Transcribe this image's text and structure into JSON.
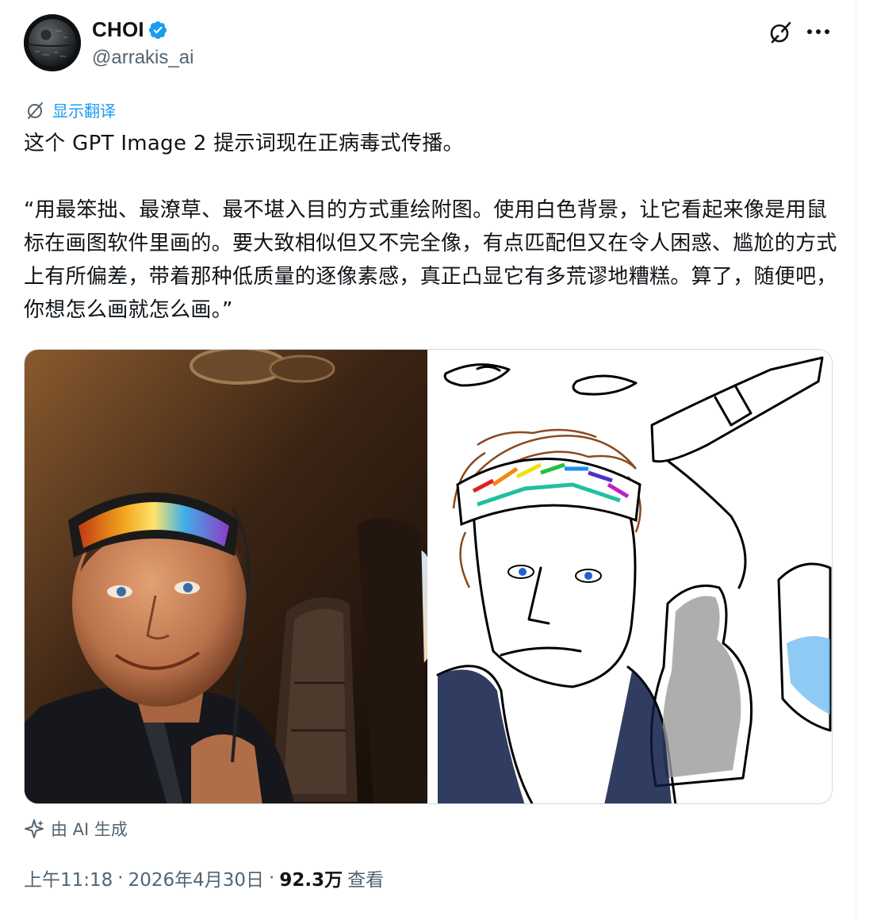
{
  "author": {
    "display_name": "CHOI",
    "handle": "@arrakis_ai",
    "verified_icon": "verified-badge-icon"
  },
  "actions": {
    "grok_icon": "grok-slash-icon",
    "more_icon": "more-dots-icon"
  },
  "translate": {
    "label": "显示翻译",
    "icon": "grok-slash-icon"
  },
  "tweet": {
    "text": "这个 GPT Image 2 提示词现在正病毒式传播。\n\n“用最笨拙、最潦草、最不堪入目的方式重绘附图。使用白色背景，让它看起来像是用鼠标在画图软件里画的。要大致相似但又不完全像，有点匹配但又在令人困惑、尴尬的方式上有所偏差，带着那种低质量的逐像素感，真正凸显它有多荒谬地糟糕。算了，随便吧，你想怎么画就怎么画。”"
  },
  "media": {
    "photo_icon": "cabin-selfie-photo",
    "drawing_icon": "crude-paint-drawing"
  },
  "ai_label": {
    "icon": "sparkle-icon",
    "text": "由 AI 生成"
  },
  "meta": {
    "time": "上午11:18",
    "date": "2026年4月30日",
    "separator": "·",
    "views_count": "92.3万",
    "views_label": "查看"
  },
  "colors": {
    "accent": "#1d9bf0",
    "secondary_text": "#536471",
    "primary_text": "#0f1419",
    "border": "#cfd9de"
  }
}
